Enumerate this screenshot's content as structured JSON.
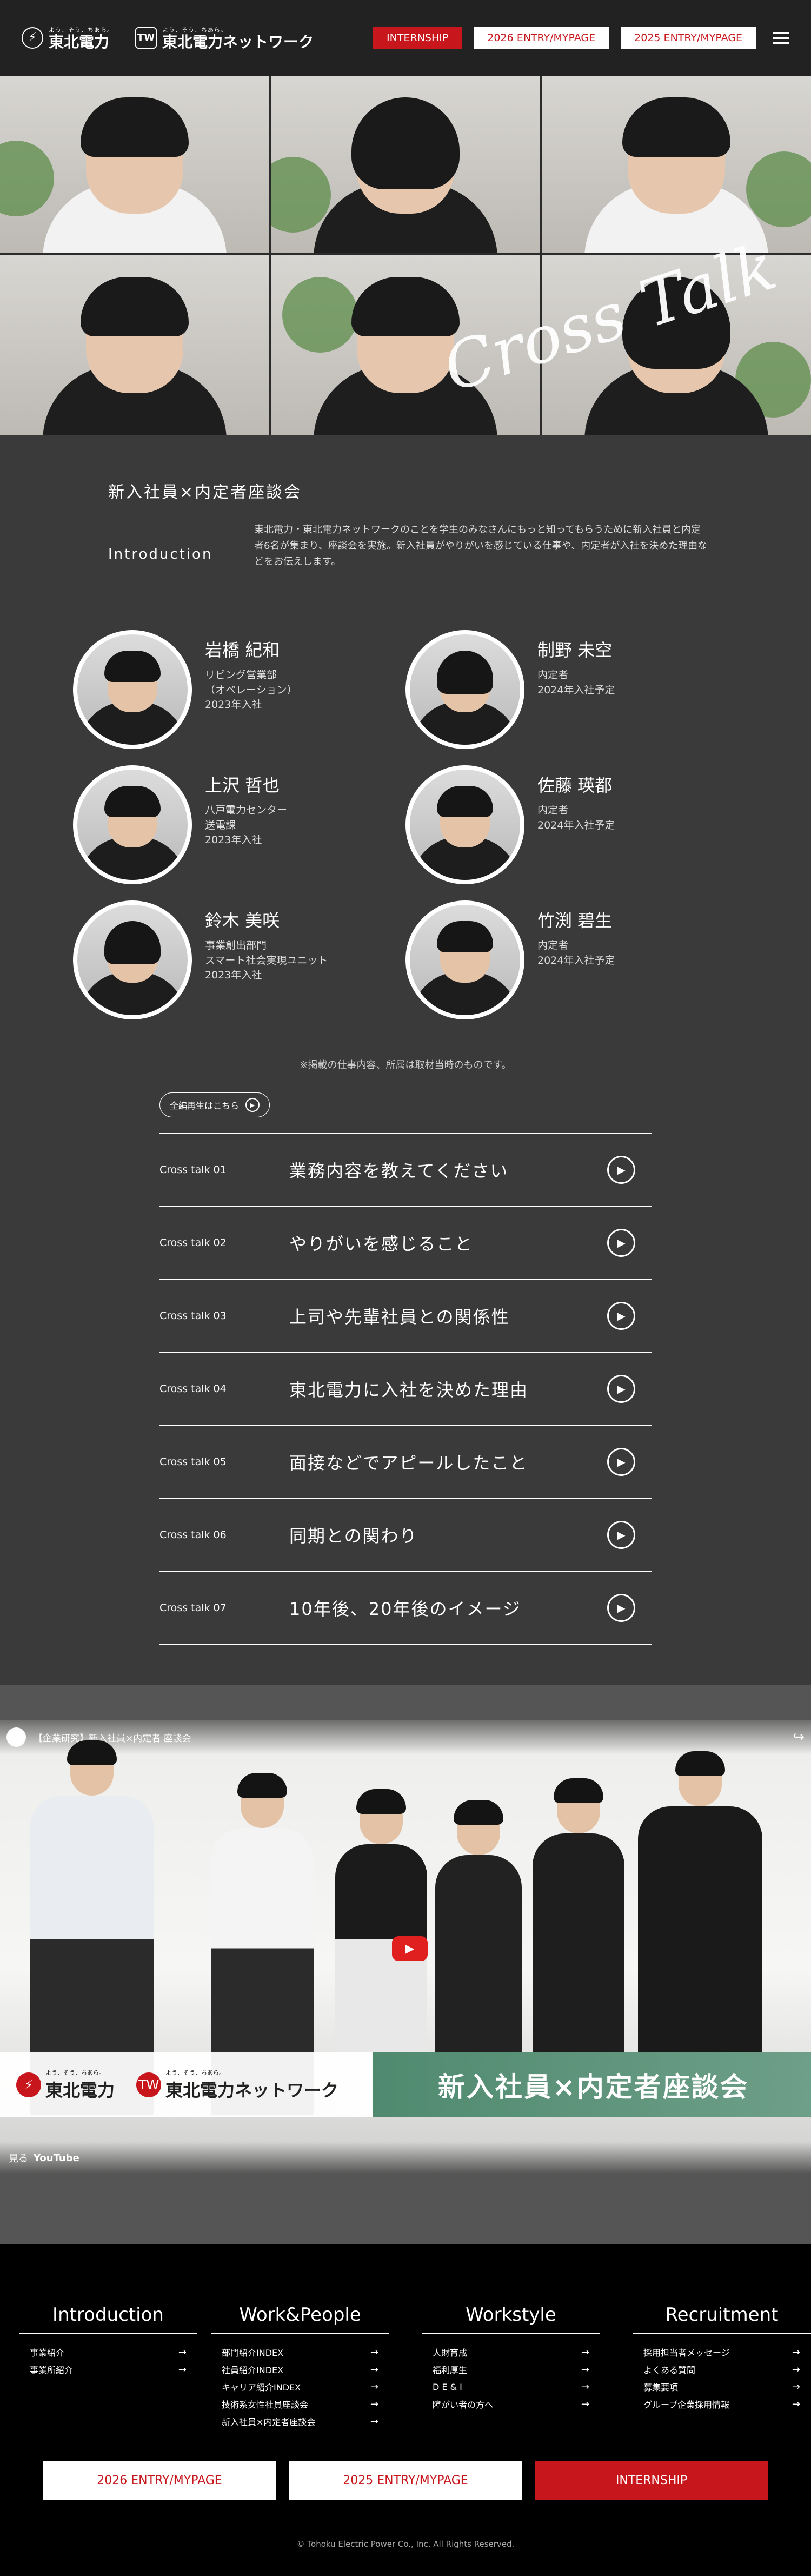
{
  "header": {
    "logo1_tag": "よう、そう、ちあら。",
    "logo1_name": "東北電力",
    "logo2_tag": "よう、そう、ちあら。",
    "logo2_name": "東北電力ネットワーク",
    "internship_label": "INTERNSHIP",
    "entry2026_label": "2026 ENTRY/MYPAGE",
    "entry2025_label": "2025 ENTRY/MYPAGE"
  },
  "hero": {
    "script_title": "Cross Talk"
  },
  "section": {
    "title": "新入社員×内定者座談会",
    "intro_label": "Introduction",
    "intro_text": "東北電力・東北電力ネットワークのことを学生のみなさんにもっと知ってもらうために新入社員と内定者6名が集まり、座談会を実施。新入社員がやりがいを感じている仕事や、内定者が入社を決めた理由などをお伝えします。"
  },
  "members": [
    {
      "name": "岩橋 紀和",
      "lines": [
        "リビング営業部",
        "（オペレーション）",
        "2023年入社"
      ]
    },
    {
      "name": "制野 未空",
      "lines": [
        "内定者",
        "2024年入社予定"
      ]
    },
    {
      "name": "上沢 哲也",
      "lines": [
        "八戸電力センター",
        "送電課",
        "2023年入社"
      ]
    },
    {
      "name": "佐藤 瑛都",
      "lines": [
        "内定者",
        "2024年入社予定"
      ]
    },
    {
      "name": "鈴木 美咲",
      "lines": [
        "事業創出部門",
        "スマート社会実現ユニット",
        "2023年入社"
      ]
    },
    {
      "name": "竹渕 碧生",
      "lines": [
        "内定者",
        "2024年入社予定"
      ]
    }
  ],
  "note": "※掲載の仕事内容、所属は取材当時のものです。",
  "all_play_label": "全編再生はこちら",
  "talks": [
    {
      "num": "Cross talk 01",
      "title": "業務内容を教えてください"
    },
    {
      "num": "Cross talk 02",
      "title": "やりがいを感じること"
    },
    {
      "num": "Cross talk 03",
      "title": "上司や先輩社員との関係性"
    },
    {
      "num": "Cross talk 04",
      "title": "東北電力に入社を決めた理由"
    },
    {
      "num": "Cross talk 05",
      "title": "面接などでアピールしたこと"
    },
    {
      "num": "Cross talk 06",
      "title": "同期との関わり"
    },
    {
      "num": "Cross talk 07",
      "title": "10年後、20年後のイメージ"
    }
  ],
  "video": {
    "top_title": "【企業研究】新入社員×内定者 座談会",
    "banner_logo1_tag": "よう、そう、ちあら。",
    "banner_logo1_name": "東北電力",
    "banner_logo2_tag": "よう、そう、ちあら。",
    "banner_logo2_name": "東北電力ネットワーク",
    "banner_title": "新入社員×内定者座談会",
    "watch_label": "見る",
    "youtube_label": "YouTube"
  },
  "footer": {
    "columns": [
      {
        "title": "Introduction",
        "links": [
          "事業紹介",
          "事業所紹介"
        ]
      },
      {
        "title": "Work&People",
        "links": [
          "部門紹介INDEX",
          "社員紹介INDEX",
          "キャリア紹介INDEX",
          "技術系女性社員座談会",
          "新入社員×内定者座談会"
        ]
      },
      {
        "title": "Workstyle",
        "links": [
          "人財育成",
          "福利厚生",
          "D E & I",
          "障がい者の方へ"
        ]
      },
      {
        "title": "Recruitment",
        "links": [
          "採用担当者メッセージ",
          "よくある質問",
          "募集要項",
          "グループ企業採用情報"
        ]
      }
    ],
    "btn_2026": "2026 ENTRY/MYPAGE",
    "btn_2025": "2025 ENTRY/MYPAGE",
    "btn_internship": "INTERNSHIP",
    "copyright": "© Tohoku Electric Power Co., Inc. All Rights Reserved."
  },
  "colors": {
    "brand_red": "#c8161d",
    "section_bg": "#3a3a3a",
    "accent_green": "#5b9479"
  }
}
